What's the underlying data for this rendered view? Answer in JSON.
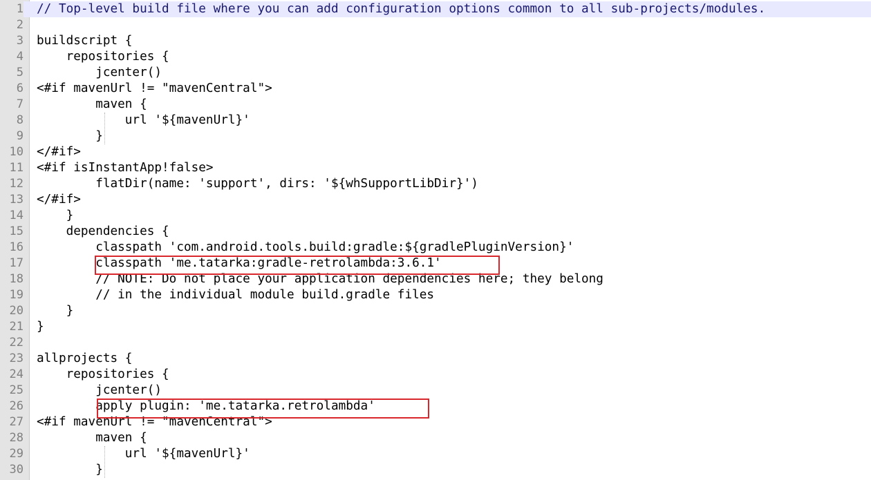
{
  "editor": {
    "lines": [
      {
        "n": "1",
        "text": "// Top-level build file where you can add configuration options common to all sub-projects/modules."
      },
      {
        "n": "2",
        "text": ""
      },
      {
        "n": "3",
        "text": "buildscript {"
      },
      {
        "n": "4",
        "text": "    repositories {"
      },
      {
        "n": "5",
        "text": "        jcenter()"
      },
      {
        "n": "6",
        "text": "<#if mavenUrl != \"mavenCentral\">"
      },
      {
        "n": "7",
        "text": "        maven {"
      },
      {
        "n": "8",
        "text": "            url '${mavenUrl}'"
      },
      {
        "n": "9",
        "text": "        }"
      },
      {
        "n": "10",
        "text": "</#if>"
      },
      {
        "n": "11",
        "text": "<#if isInstantApp!false>"
      },
      {
        "n": "12",
        "text": "        flatDir(name: 'support', dirs: '${whSupportLibDir}')"
      },
      {
        "n": "13",
        "text": "</#if>"
      },
      {
        "n": "14",
        "text": "    }"
      },
      {
        "n": "15",
        "text": "    dependencies {"
      },
      {
        "n": "16",
        "text": "        classpath 'com.android.tools.build:gradle:${gradlePluginVersion}'"
      },
      {
        "n": "17",
        "text": "        classpath 'me.tatarka:gradle-retrolambda:3.6.1'"
      },
      {
        "n": "18",
        "text": "        // NOTE: Do not place your application dependencies here; they belong"
      },
      {
        "n": "19",
        "text": "        // in the individual module build.gradle files"
      },
      {
        "n": "20",
        "text": "    }"
      },
      {
        "n": "21",
        "text": "}"
      },
      {
        "n": "22",
        "text": ""
      },
      {
        "n": "23",
        "text": "allprojects {"
      },
      {
        "n": "24",
        "text": "    repositories {"
      },
      {
        "n": "25",
        "text": "        jcenter()"
      },
      {
        "n": "26",
        "text": "        apply plugin: 'me.tatarka.retrolambda'"
      },
      {
        "n": "27",
        "text": "<#if mavenUrl != \"mavenCentral\">"
      },
      {
        "n": "28",
        "text": "        maven {"
      },
      {
        "n": "29",
        "text": "            url '${mavenUrl}'"
      },
      {
        "n": "30",
        "text": "        }"
      }
    ],
    "current_line": "1",
    "highlighted_lines": [
      "17",
      "26"
    ],
    "colors": {
      "highlight_box": "#d9262c",
      "current_line_bg": "#e8e8ff",
      "gutter_bg": "#e4e4e4",
      "line_number": "#808080"
    }
  }
}
